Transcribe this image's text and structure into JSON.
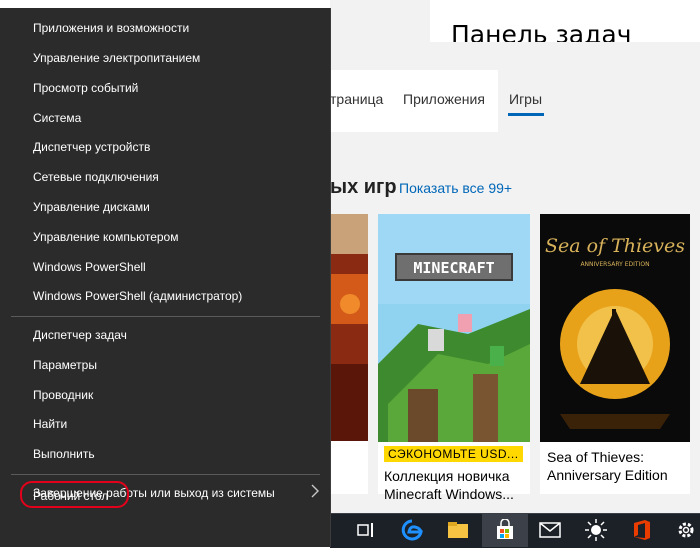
{
  "settings": {
    "title": "Панель задач"
  },
  "store": {
    "tabs": [
      "траница",
      "Приложения",
      "Игры"
    ],
    "section_title": "ых игр",
    "show_all": "Показать все 99+",
    "cards": [
      {
        "badge": "СЭКОНОМЬТЕ USD...",
        "line1": "Коллекция новичка",
        "line2": "Minecraft Windows..."
      },
      {
        "line1": "Sea of Thieves:",
        "line2": "Anniversary Edition"
      }
    ],
    "art": {
      "minecraft_logo": "MINECRAFT",
      "sot_logo": "Sea of Thieves",
      "sot_sub": "ANNIVERSARY EDITION"
    }
  },
  "winx_menu": {
    "group1": [
      "Приложения и возможности",
      "Управление электропитанием",
      "Просмотр событий",
      "Система",
      "Диспетчер устройств",
      "Сетевые подключения",
      "Управление дисками",
      "Управление компьютером",
      "Windows PowerShell",
      "Windows PowerShell (администратор)"
    ],
    "group2": [
      "Диспетчер задач",
      "Параметры",
      "Проводник",
      "Найти",
      "Выполнить"
    ],
    "group3": [
      "Завершение работы или выход из системы",
      "Рабочий стол"
    ]
  },
  "taskbar": {
    "icons": [
      "task-view-icon",
      "edge-icon",
      "file-explorer-icon",
      "store-icon",
      "mail-icon",
      "brightness-icon",
      "office-icon",
      "settings-gear-icon"
    ]
  },
  "colors": {
    "menu_bg": "#2b2b2b",
    "accent": "#0067b8",
    "highlight": "#e3001b",
    "badge": "#ffd800"
  }
}
